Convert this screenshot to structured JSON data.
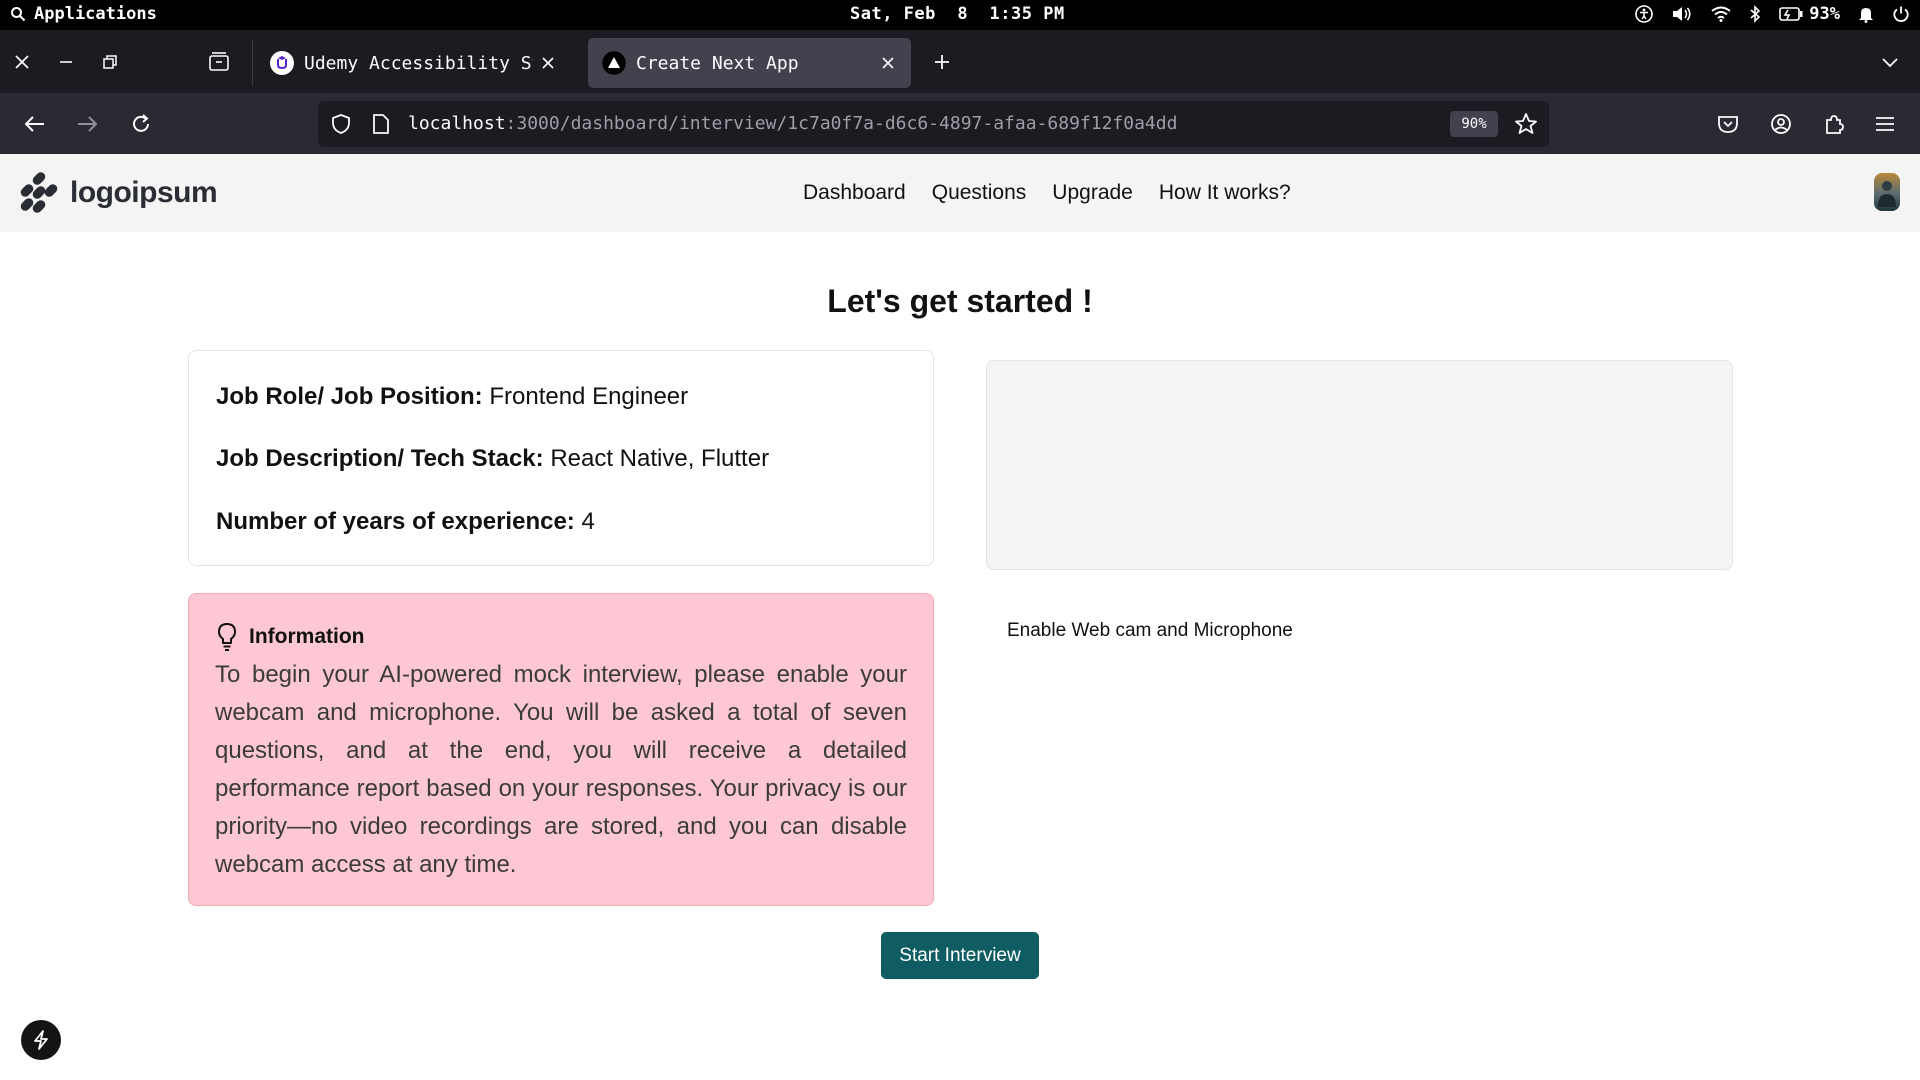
{
  "os_bar": {
    "apps_label": "Applications",
    "datetime": "Sat, Feb  8  1:35 PM",
    "battery": "93%"
  },
  "browser": {
    "tabs": [
      {
        "title": "Udemy Accessibility Sta",
        "icon": "udemy-icon",
        "active": false
      },
      {
        "title": "Create Next App",
        "icon": "nextjs-icon",
        "active": true
      }
    ],
    "url_host": "localhost",
    "url_path": ":3000/dashboard/interview/1c7a0f7a-d6c6-4897-afaa-689f12f0a4dd",
    "zoom": "90%"
  },
  "header": {
    "logo_text": "logoipsum",
    "nav": [
      "Dashboard",
      "Questions",
      "Upgrade",
      "How It works?"
    ]
  },
  "main": {
    "title": "Let's get started !",
    "job": {
      "role_label": "Job Role/ Job Position:",
      "role_value": "Frontend Engineer",
      "desc_label": "Job Description/ Tech Stack:",
      "desc_value": "React Native, Flutter",
      "exp_label": "Number of years of experience:",
      "exp_value": "4"
    },
    "info": {
      "heading": "Information",
      "body": "To begin your AI-powered mock interview, please enable your webcam and microphone. You will be asked a total of seven questions, and at the end, you will receive a detailed performance report based on your responses. Your privacy is our priority—no video recordings are stored, and you can disable webcam access at any time."
    },
    "enable_label": "Enable Web cam and Microphone",
    "start_label": "Start Interview"
  },
  "colors": {
    "primary": "#0f5d63",
    "info_bg": "#fdc8d3",
    "header_bg": "#f4f4f4"
  }
}
